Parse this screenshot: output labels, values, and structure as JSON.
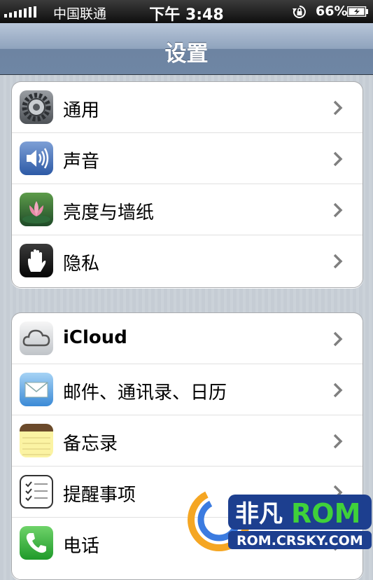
{
  "status_bar": {
    "carrier": "中国联通",
    "time": "下午 3:48",
    "battery": "66%"
  },
  "nav": {
    "title": "设置"
  },
  "groups": [
    {
      "items": [
        {
          "label": "通用",
          "icon": "gear-icon"
        },
        {
          "label": "声音",
          "icon": "speaker-icon"
        },
        {
          "label": "亮度与墙纸",
          "icon": "lotus-icon"
        },
        {
          "label": "隐私",
          "icon": "hand-icon"
        }
      ]
    },
    {
      "items": [
        {
          "label": "iCloud",
          "icon": "cloud-icon"
        },
        {
          "label": "邮件、通讯录、日历",
          "icon": "mail-icon"
        },
        {
          "label": "备忘录",
          "icon": "notes-icon"
        },
        {
          "label": "提醒事项",
          "icon": "reminders-icon"
        },
        {
          "label": "电话",
          "icon": "phone-icon"
        }
      ]
    }
  ],
  "watermark": {
    "brand": "非凡",
    "rom": "ROM",
    "url": "ROM.CRSKY.COM"
  },
  "colors": {
    "nav_blue": "#6d84a2",
    "background_stripe": "#c5ccd4",
    "chevron": "#7f7f7f"
  }
}
